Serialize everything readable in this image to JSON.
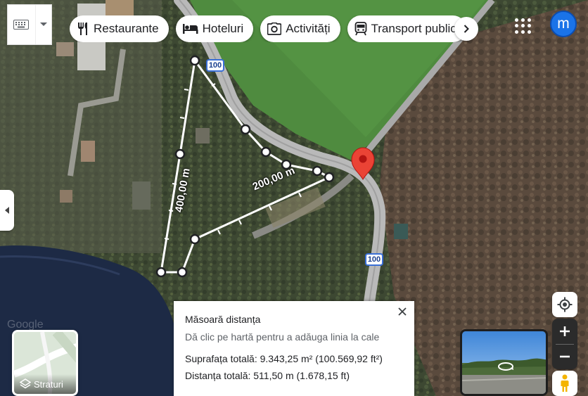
{
  "top_bar": {
    "keyboard_icon": "keyboard-icon",
    "chips": [
      {
        "label": "Restaurante",
        "icon": "fork-knife-icon"
      },
      {
        "label": "Hoteluri",
        "icon": "bed-icon"
      },
      {
        "label": "Activități",
        "icon": "camera-icon"
      },
      {
        "label": "Transport public",
        "icon": "train-icon"
      }
    ],
    "avatar_letter": "m"
  },
  "map": {
    "road_shield_label": "100",
    "measure_labels": {
      "segment_a": "400,00 m",
      "segment_b": "200,00 m"
    }
  },
  "panel": {
    "title": "Măsoară distanța",
    "hint": "Dă clic pe hartă pentru a adăuga linia la cale",
    "area": "Suprafața totală: 9.343,25 m² (100.569,92 ft²)",
    "distance": "Distanța totală: 511,50 m (1.678,15 ft)"
  },
  "layers": {
    "label": "Straturi"
  },
  "colors": {
    "accent": "#1a73e8",
    "pin": "#ea4335",
    "road": "#b9b9b9",
    "field": "#4f8b3f",
    "water": "#1d2a45"
  }
}
